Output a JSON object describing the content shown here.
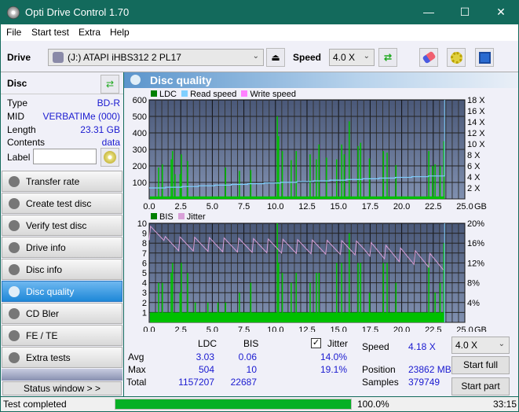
{
  "window": {
    "title": "Opti Drive Control 1.70",
    "minimize": "—",
    "maximize": "☐",
    "close": "✕"
  },
  "menu": [
    "File",
    "Start test",
    "Extra",
    "Help"
  ],
  "toolbar": {
    "drive_label": "Drive",
    "drive_value": "(J:)  ATAPI iHBS312  2 PL17",
    "speed_label": "Speed",
    "speed_value": "4.0 X",
    "icons": [
      "eject-icon",
      "refresh-icon",
      "eraser-icon",
      "gears-icon",
      "save-icon"
    ]
  },
  "disc": {
    "header": "Disc",
    "rows": [
      {
        "label": "Type",
        "value": "BD-R"
      },
      {
        "label": "MID",
        "value": "VERBATIMe (000)"
      },
      {
        "label": "Length",
        "value": "23.31 GB"
      },
      {
        "label": "Contents",
        "value": "data"
      }
    ],
    "label_field_label": "Label",
    "label_field_value": ""
  },
  "nav": [
    {
      "label": "Transfer rate",
      "active": false
    },
    {
      "label": "Create test disc",
      "active": false
    },
    {
      "label": "Verify test disc",
      "active": false
    },
    {
      "label": "Drive info",
      "active": false
    },
    {
      "label": "Disc info",
      "active": false
    },
    {
      "label": "Disc quality",
      "active": true
    },
    {
      "label": "CD Bler",
      "active": false
    },
    {
      "label": "FE / TE",
      "active": false
    },
    {
      "label": "Extra tests",
      "active": false
    }
  ],
  "status_window_button": "Status window > >",
  "panel_title": "Disc quality",
  "colors": {
    "ldc": "#00c000",
    "read_speed": "#7fcfff",
    "write_speed": "#ff80ff",
    "bis": "#00c000",
    "jitter": "#d8a0d8",
    "plot_bg_top": "#4a5878",
    "plot_bg_bottom": "#8090b0"
  },
  "chart_data": [
    {
      "type": "bar",
      "title": "LDC",
      "legend": [
        "LDC",
        "Read speed",
        "Write speed"
      ],
      "xlabel": "GB",
      "x_ticks": [
        "0.0",
        "2.5",
        "5.0",
        "7.5",
        "10.0",
        "12.5",
        "15.0",
        "17.5",
        "20.0",
        "22.5",
        "25.0"
      ],
      "xlim": [
        0,
        25
      ],
      "y_ticks": [
        "100",
        "200",
        "300",
        "400",
        "500",
        "600"
      ],
      "ylim": [
        0,
        600
      ],
      "y2_ticks": [
        "2 X",
        "4 X",
        "6 X",
        "8 X",
        "10 X",
        "12 X",
        "14 X",
        "16 X",
        "18 X"
      ],
      "y2lim": [
        0,
        18
      ],
      "ldc_spikes": [
        [
          0.7,
          190
        ],
        [
          1.0,
          210
        ],
        [
          1.7,
          240
        ],
        [
          1.8,
          290
        ],
        [
          2.0,
          150
        ],
        [
          2.4,
          150
        ],
        [
          2.5,
          270
        ],
        [
          3.0,
          230
        ],
        [
          6.0,
          190
        ],
        [
          7.1,
          170
        ],
        [
          8.0,
          175
        ],
        [
          10.1,
          500
        ],
        [
          10.2,
          380
        ],
        [
          10.5,
          290
        ],
        [
          11.2,
          235
        ],
        [
          11.6,
          290
        ],
        [
          12.7,
          270
        ],
        [
          13.2,
          240
        ],
        [
          13.4,
          330
        ],
        [
          14.0,
          250
        ],
        [
          14.8,
          240
        ],
        [
          15.2,
          330
        ],
        [
          15.4,
          270
        ],
        [
          15.8,
          470
        ],
        [
          16.5,
          320
        ],
        [
          16.7,
          340
        ],
        [
          17.4,
          245
        ],
        [
          18.5,
          290
        ],
        [
          18.8,
          280
        ],
        [
          19.5,
          205
        ],
        [
          22.1,
          290
        ],
        [
          22.4,
          200
        ],
        [
          22.6,
          210
        ],
        [
          23.0,
          200
        ],
        [
          23.3,
          350
        ]
      ],
      "ldc_baseline": 15,
      "read_speed": {
        "x": [
          0,
          23.4
        ],
        "y": [
          2.0,
          4.3
        ]
      },
      "end_marker_x": 23.4
    },
    {
      "type": "bar",
      "title": "BIS / Jitter",
      "legend": [
        "BIS",
        "Jitter"
      ],
      "xlabel": "GB",
      "x_ticks": [
        "0.0",
        "2.5",
        "5.0",
        "7.5",
        "10.0",
        "12.5",
        "15.0",
        "17.5",
        "20.0",
        "22.5",
        "25.0"
      ],
      "xlim": [
        0,
        25
      ],
      "y_ticks": [
        "1",
        "2",
        "3",
        "4",
        "5",
        "6",
        "7",
        "8",
        "9",
        "10"
      ],
      "ylim": [
        0,
        10
      ],
      "y2_ticks": [
        "4%",
        "8%",
        "12%",
        "16%",
        "20%"
      ],
      "y2lim": [
        0,
        20
      ],
      "bis_spikes": [
        [
          0.7,
          4
        ],
        [
          1.0,
          4
        ],
        [
          1.7,
          5
        ],
        [
          1.8,
          6
        ],
        [
          2.4,
          3
        ],
        [
          2.5,
          6
        ],
        [
          3.0,
          5
        ],
        [
          3.6,
          2
        ],
        [
          4.6,
          2
        ],
        [
          5.4,
          2
        ],
        [
          6.0,
          2
        ],
        [
          7.1,
          3
        ],
        [
          8.0,
          4
        ],
        [
          10.1,
          10
        ],
        [
          10.2,
          6
        ],
        [
          10.5,
          5
        ],
        [
          11.2,
          4
        ],
        [
          11.6,
          5
        ],
        [
          12.7,
          4
        ],
        [
          13.2,
          5
        ],
        [
          13.4,
          5
        ],
        [
          14.8,
          6
        ],
        [
          15.2,
          6
        ],
        [
          15.8,
          9
        ],
        [
          16.5,
          6
        ],
        [
          16.7,
          6
        ],
        [
          17.4,
          3
        ],
        [
          18.5,
          6
        ],
        [
          18.8,
          6
        ],
        [
          19.5,
          4
        ],
        [
          22.1,
          6
        ],
        [
          22.6,
          3
        ],
        [
          23.0,
          4
        ],
        [
          23.3,
          8
        ]
      ],
      "bis_baseline": 1,
      "jitter": {
        "start": 16.0,
        "mid_x": 17.0,
        "mid": 15.0,
        "end_x": 23.3,
        "end": 12.0
      }
    }
  ],
  "stats": {
    "col_ldc": "LDC",
    "col_bis": "BIS",
    "rows": [
      {
        "label": "Avg",
        "ldc": "3.03",
        "bis": "0.06",
        "jitter": "14.0%"
      },
      {
        "label": "Max",
        "ldc": "504",
        "bis": "10",
        "jitter": "19.1%"
      },
      {
        "label": "Total",
        "ldc": "1157207",
        "bis": "22687",
        "jitter": ""
      }
    ],
    "jitter_label": "Jitter",
    "jitter_checked": true,
    "speed_label": "Speed",
    "speed_value": "4.18 X",
    "position_label": "Position",
    "position_value": "23862 MB",
    "samples_label": "Samples",
    "samples_value": "379749",
    "speed_select": "4.0 X",
    "start_full": "Start full",
    "start_part": "Start part"
  },
  "statusbar": {
    "text": "Test completed",
    "progress": 100.0,
    "progress_text": "100.0%",
    "time": "33:15"
  }
}
